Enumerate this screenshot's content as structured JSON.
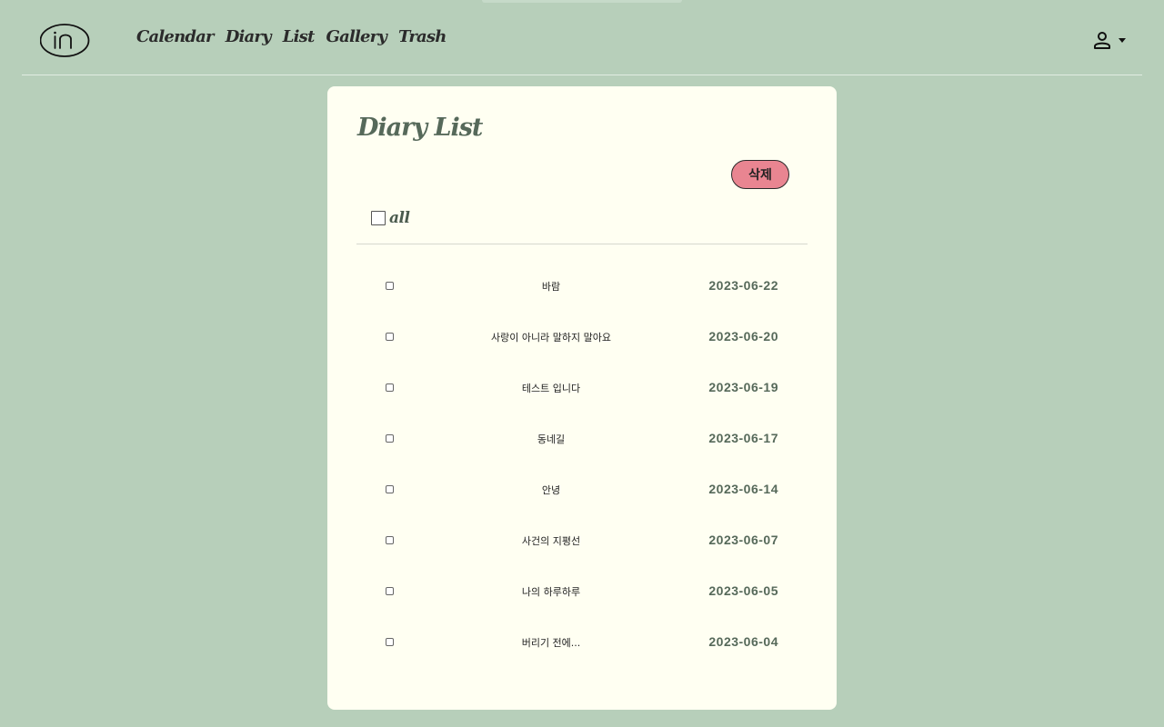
{
  "nav": {
    "logo_text": "in",
    "links": [
      "Calendar",
      "Diary",
      "List",
      "Gallery",
      "Trash"
    ]
  },
  "card": {
    "title": "Diary List",
    "delete_label": "삭제",
    "all_label": "all"
  },
  "entries": [
    {
      "title": "바람",
      "date": "2023-06-22"
    },
    {
      "title": "사랑이 아니라 말하지 말아요",
      "date": "2023-06-20"
    },
    {
      "title": "테스트 입니다",
      "date": "2023-06-19"
    },
    {
      "title": "동네길",
      "date": "2023-06-17"
    },
    {
      "title": "안녕",
      "date": "2023-06-14"
    },
    {
      "title": "사건의 지평선",
      "date": "2023-06-07"
    },
    {
      "title": "나의 하루하루",
      "date": "2023-06-05"
    },
    {
      "title": "버리기 전에...",
      "date": "2023-06-04"
    }
  ],
  "colors": {
    "background": "#b7cfba",
    "card": "#fffff2",
    "accent_text": "#56695a",
    "delete_button": "#e98591"
  },
  "icons": [
    "logo",
    "user-icon",
    "caret-down-icon"
  ]
}
